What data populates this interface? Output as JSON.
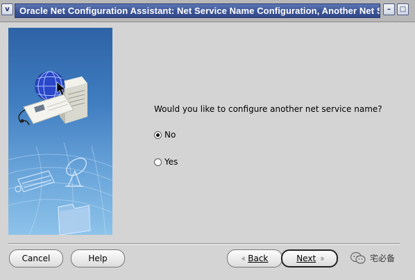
{
  "window": {
    "title": "Oracle Net Configuration Assistant: Net Service Name Configuration, Another Net S",
    "menu_glyph": "v",
    "minimize_glyph": "–",
    "maximize_glyph": "□"
  },
  "content": {
    "question": "Would you like to configure another net service name?",
    "options": [
      {
        "label": "No",
        "selected": true
      },
      {
        "label": "Yes",
        "selected": false
      }
    ]
  },
  "buttons": {
    "cancel": "Cancel",
    "help": "Help",
    "back": "Back",
    "next": "Next"
  },
  "watermark": {
    "text": "宅必备"
  },
  "colors": {
    "title_bar": "#3c5496",
    "dialog_bg": "#d4d4d4",
    "banner_top": "#2e63a6",
    "banner_bottom": "#8dc3ea"
  }
}
